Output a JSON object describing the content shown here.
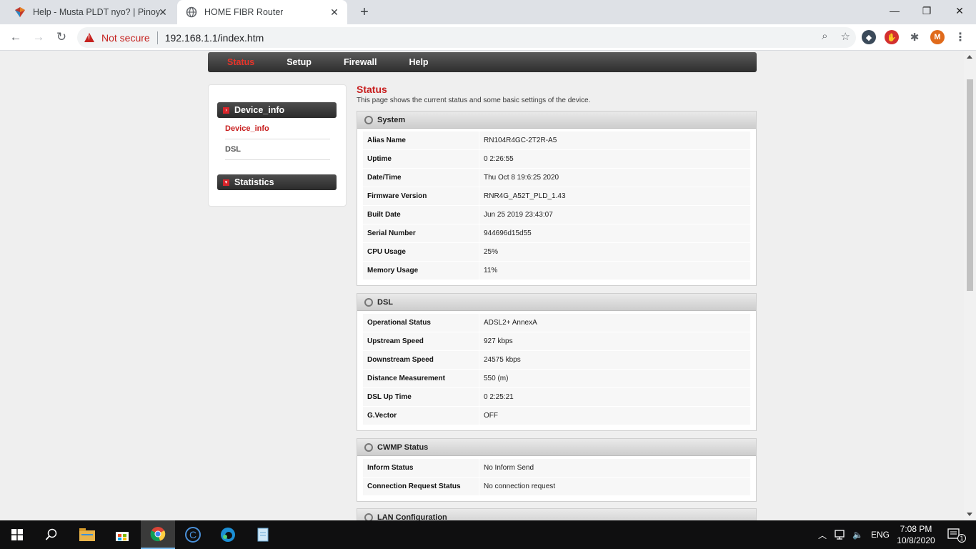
{
  "browser": {
    "tabs": [
      {
        "title": "Help - Musta PLDT nyo? | Pinoy",
        "active": false
      },
      {
        "title": "HOME FIBR Router",
        "active": true
      }
    ],
    "security_label": "Not secure",
    "url": "192.168.1.1/index.htm",
    "profile_initial": "M"
  },
  "menu": {
    "items": [
      "Status",
      "Setup",
      "Firewall",
      "Help"
    ],
    "active": "Status"
  },
  "sidebar": {
    "groups": [
      {
        "title": "Device_info",
        "items": [
          "Device_info",
          "DSL"
        ]
      },
      {
        "title": "Statistics",
        "items": []
      }
    ]
  },
  "page": {
    "title": "Status",
    "description": "This page shows the current status and some basic settings of the device."
  },
  "sections": {
    "system": {
      "title": "System",
      "rows": [
        {
          "label": "Alias Name",
          "value": "RN104R4GC-2T2R-A5"
        },
        {
          "label": "Uptime",
          "value": "0 2:26:55"
        },
        {
          "label": "Date/Time",
          "value": "Thu Oct 8 19:6:25 2020"
        },
        {
          "label": "Firmware Version",
          "value": "RNR4G_A52T_PLD_1.43"
        },
        {
          "label": "Built Date",
          "value": "Jun 25 2019 23:43:07"
        },
        {
          "label": "Serial Number",
          "value": "944696d15d55"
        },
        {
          "label": "CPU Usage",
          "value": "25%"
        },
        {
          "label": "Memory Usage",
          "value": "11%"
        }
      ]
    },
    "dsl": {
      "title": "DSL",
      "rows": [
        {
          "label": "Operational Status",
          "value": "ADSL2+ AnnexA"
        },
        {
          "label": "Upstream Speed",
          "value": "927 kbps"
        },
        {
          "label": "Downstream Speed",
          "value": "24575 kbps"
        },
        {
          "label": "Distance Measurement",
          "value": "550 (m)"
        },
        {
          "label": "DSL Up Time",
          "value": "0 2:25:21"
        },
        {
          "label": "G.Vector",
          "value": "OFF"
        }
      ]
    },
    "cwmp": {
      "title": "CWMP Status",
      "rows": [
        {
          "label": "Inform Status",
          "value": "No Inform Send"
        },
        {
          "label": "Connection Request Status",
          "value": "No connection request"
        }
      ]
    },
    "lan": {
      "title": "LAN Configuration"
    }
  },
  "taskbar": {
    "language": "ENG",
    "time": "7:08 PM",
    "date": "10/8/2020",
    "notification_count": "1"
  }
}
